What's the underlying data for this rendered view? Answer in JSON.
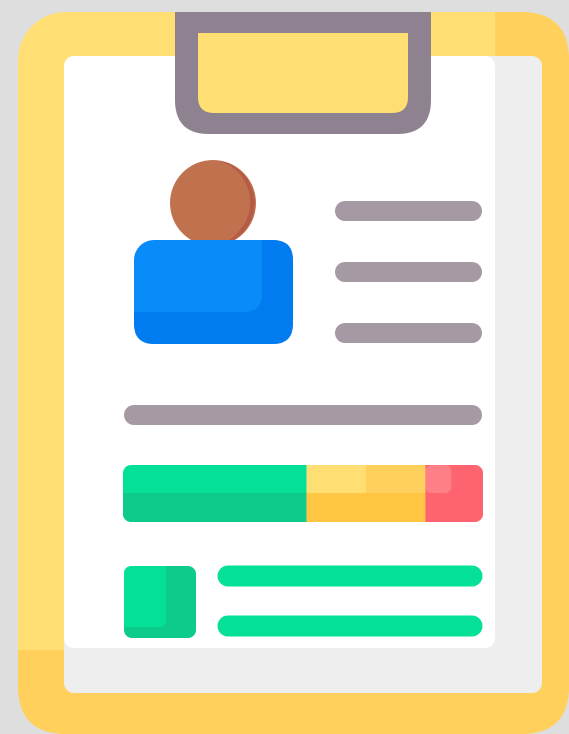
{
  "illustration": {
    "name": "clipboard-profile",
    "icon": "clipboard-resume-icon"
  },
  "colors": {
    "background": "#dedede",
    "board": "#ffdf74",
    "board_shade": "#ffd15c",
    "paper": "#ffffff",
    "paper_shade": "#eeeeee",
    "clip": "#8e8290",
    "clip_inner": "#ffdf74",
    "head": "#c0714e",
    "head_shade": "#b65a45",
    "body": "#0a8bfa",
    "body_shade": "#007cf0",
    "text_line": "#a59aa3",
    "green": "#05e098",
    "green_shade": "#0fcb8b",
    "yellow": "#ffdf74",
    "yellow_shade": "#ffc543",
    "red": "#fe646f",
    "red_light": "#ff7f86"
  },
  "rating": {
    "good": 0.51,
    "average": 0.33,
    "poor": 0.16
  }
}
